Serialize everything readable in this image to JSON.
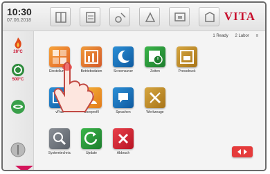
{
  "header": {
    "time": "10:30",
    "date": "07.06.2018",
    "brand": "VITA",
    "toolbar_icons": [
      "program-icon",
      "firing-icon",
      "dental-icon",
      "settings-icon",
      "display-icon",
      "info-icon"
    ]
  },
  "rail": {
    "items": [
      {
        "icon": "flame-icon",
        "temp": "28°C"
      },
      {
        "icon": "recycle-icon",
        "temp": "500°C"
      },
      {
        "icon": "oven-icon",
        "temp": ""
      },
      {
        "icon": "power-icon",
        "temp": ""
      }
    ]
  },
  "status": {
    "ready": "1 Ready",
    "labor": "2 Labor",
    "more": "≡"
  },
  "tiles": [
    {
      "label": "Einstellungen",
      "icon": "settings-grid-icon"
    },
    {
      "label": "Betriebsdaten",
      "icon": "chart-icon"
    },
    {
      "label": "Screensaver",
      "icon": "moon-icon"
    },
    {
      "label": "Zeiten",
      "icon": "clock-icon"
    },
    {
      "label": "Pressdruck",
      "icon": "press-icon"
    },
    {
      "label": "vPad",
      "icon": "tablet-icon"
    },
    {
      "label": "Userprofil",
      "icon": "user-icon"
    },
    {
      "label": "Sprachen",
      "icon": "language-icon"
    },
    {
      "label": "Werkzeuge",
      "icon": "tools-icon"
    },
    {
      "label": "Systemtechnic",
      "icon": "system-icon"
    },
    {
      "label": "Update",
      "icon": "update-icon"
    },
    {
      "label": "Abbruch",
      "icon": "cancel-icon"
    }
  ],
  "colors": {
    "brand": "#c8102e",
    "accent": "#d4145a",
    "next": "#e53b3b"
  }
}
